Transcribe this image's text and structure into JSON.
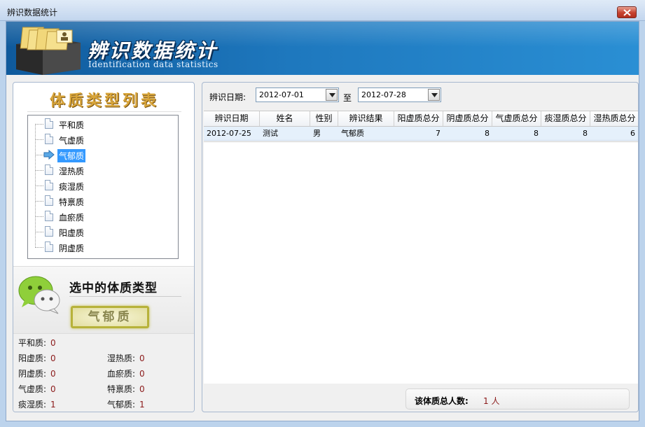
{
  "window": {
    "title": "辨识数据统计"
  },
  "banner": {
    "title": "辨识数据统计",
    "subtitle": "Identification data statistics"
  },
  "left_panel": {
    "heading": "体质类型列表",
    "tree_items": [
      "平和质",
      "气虚质",
      "气郁质",
      "湿热质",
      "痰湿质",
      "特禀质",
      "血瘀质",
      "阳虚质",
      "阴虚质"
    ],
    "selected_index": 2,
    "selected_heading": "选中的体质类型",
    "selected_type": "气郁质",
    "counts": [
      {
        "label": "平和质:",
        "value": "0"
      },
      {
        "label": "阳虚质:",
        "value": "0"
      },
      {
        "label": "湿热质:",
        "value": "0"
      },
      {
        "label": "阴虚质:",
        "value": "0"
      },
      {
        "label": "血瘀质:",
        "value": "0"
      },
      {
        "label": "气虚质:",
        "value": "0"
      },
      {
        "label": "特禀质:",
        "value": "0"
      },
      {
        "label": "痰湿质:",
        "value": "1"
      },
      {
        "label": "气郁质:",
        "value": "1"
      }
    ]
  },
  "filter": {
    "date_label": "辨识日期:",
    "from": "2012-07-01",
    "separator": "至",
    "to": "2012-07-28"
  },
  "table": {
    "columns": [
      "辨识日期",
      "姓名",
      "性别",
      "辨识结果",
      "阳虚质总分",
      "阴虚质总分",
      "气虚质总分",
      "痰湿质总分",
      "湿热质总分"
    ],
    "rows": [
      [
        "2012-07-25",
        "测试",
        "男",
        "气郁质",
        "7",
        "8",
        "8",
        "8",
        "6"
      ]
    ]
  },
  "total": {
    "label": "该体质总人数:",
    "value": "1 人"
  },
  "colors": {
    "banner": "#1e78be",
    "selection": "#3399ff",
    "value_red": "#8b1a1a",
    "heading_gold": "#d8a53a"
  }
}
